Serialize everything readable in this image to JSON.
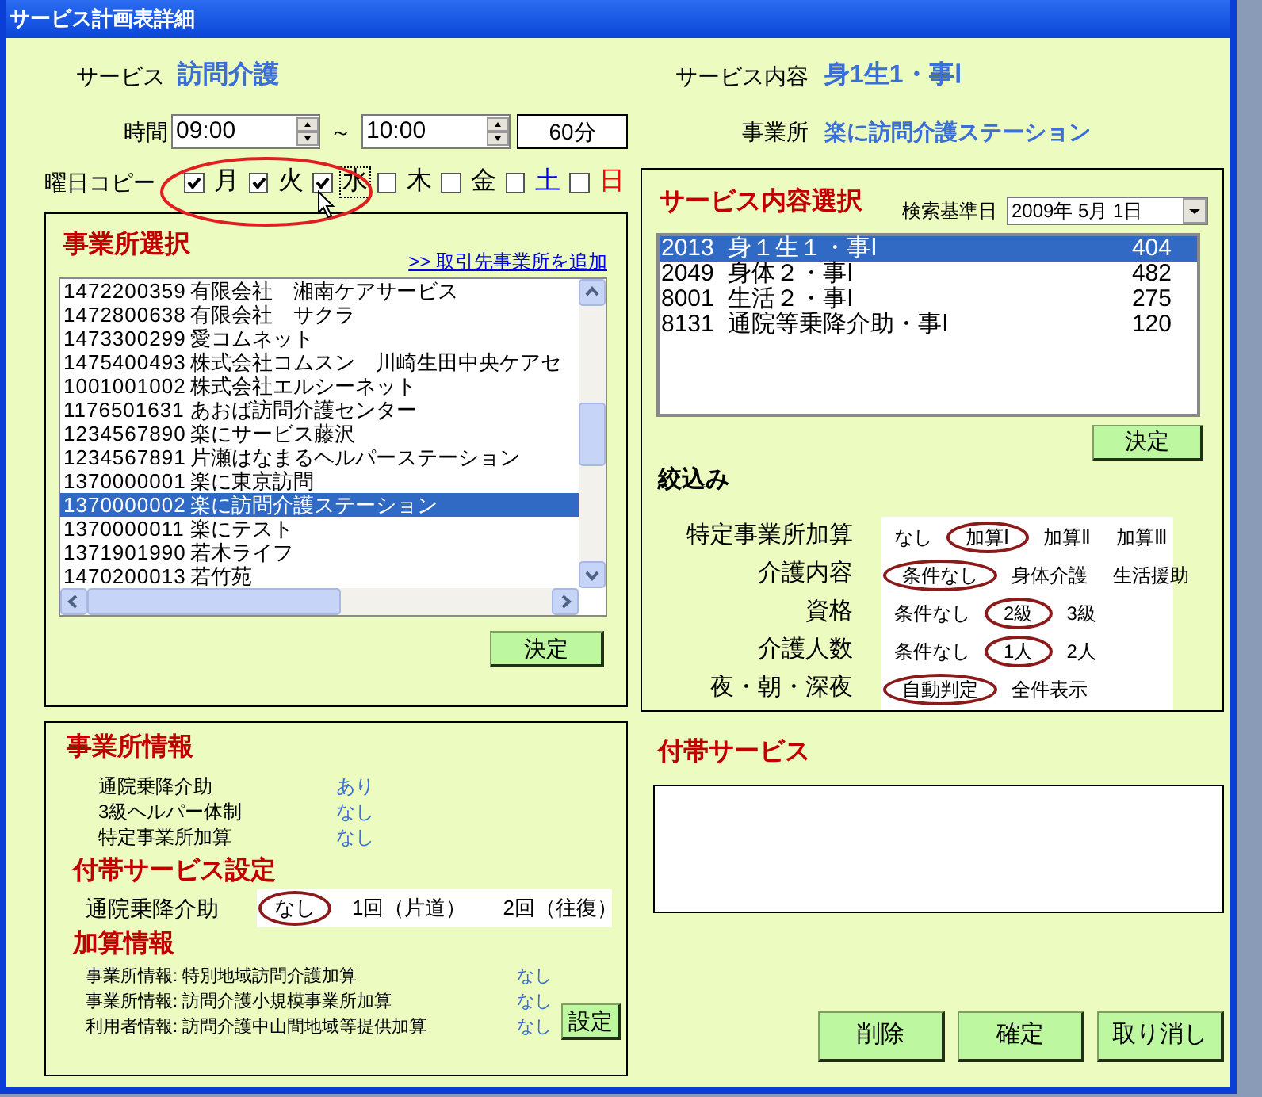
{
  "window": {
    "title": "サービス計画表詳細"
  },
  "service": {
    "label": "サービス",
    "value": "訪問介護"
  },
  "time": {
    "label": "時間",
    "start": "09:00",
    "separator": "～",
    "end": "10:00",
    "duration": "60分"
  },
  "day_copy": {
    "label": "曜日コピー",
    "days": [
      {
        "label": "月",
        "checked": true,
        "focused": false,
        "color": "#000000"
      },
      {
        "label": "火",
        "checked": true,
        "focused": false,
        "color": "#000000"
      },
      {
        "label": "水",
        "checked": true,
        "focused": true,
        "color": "#000000"
      },
      {
        "label": "木",
        "checked": false,
        "focused": false,
        "color": "#000000"
      },
      {
        "label": "金",
        "checked": false,
        "focused": false,
        "color": "#000000"
      },
      {
        "label": "土",
        "checked": false,
        "focused": false,
        "color": "#0000ff"
      },
      {
        "label": "日",
        "checked": false,
        "focused": false,
        "color": "#ff0000"
      }
    ]
  },
  "office_select": {
    "title": "事業所選択",
    "add_link": ">> 取引先事業所を追加",
    "rows": [
      {
        "code": "1472200359",
        "name": "有限会社　湘南ケアサービス",
        "selected": false
      },
      {
        "code": "1472800638",
        "name": "有限会社　サクラ",
        "selected": false
      },
      {
        "code": "1473300299",
        "name": "愛コムネット",
        "selected": false
      },
      {
        "code": "1475400493",
        "name": "株式会社コムスン　川崎生田中央ケアセ",
        "selected": false
      },
      {
        "code": "1001001002",
        "name": "株式会社エルシーネット",
        "selected": false
      },
      {
        "code": "1176501631",
        "name": "あおば訪問介護センター",
        "selected": false
      },
      {
        "code": "1234567890",
        "name": "楽にサービス藤沢",
        "selected": false
      },
      {
        "code": "1234567891",
        "name": "片瀬はなまるヘルパーステーション",
        "selected": false
      },
      {
        "code": "1370000001",
        "name": "楽に東京訪問",
        "selected": false
      },
      {
        "code": "1370000002",
        "name": "楽に訪問介護ステーション",
        "selected": true
      },
      {
        "code": "1370000011",
        "name": "楽にテスト",
        "selected": false
      },
      {
        "code": "1371901990",
        "name": "若木ライフ",
        "selected": false
      },
      {
        "code": "1470200013",
        "name": "若竹苑",
        "selected": false
      }
    ],
    "button": "決定"
  },
  "service_content": {
    "label": "サービス内容",
    "value": "身1生1・事Ⅰ"
  },
  "office": {
    "label": "事業所",
    "value": "楽に訪問介護ステーション"
  },
  "service_select": {
    "title": "サービス内容選択",
    "date_label": "検索基準日",
    "date": "2009年 5月 1日",
    "rows": [
      {
        "code": "2013",
        "name": "身１生１・事Ⅰ",
        "units": "404",
        "selected": true
      },
      {
        "code": "2049",
        "name": "身体２・事Ⅰ",
        "units": "482",
        "selected": false
      },
      {
        "code": "8001",
        "name": "生活２・事Ⅰ",
        "units": "275",
        "selected": false
      },
      {
        "code": "8131",
        "name": "通院等乗降介助・事Ⅰ",
        "units": "120",
        "selected": false
      }
    ],
    "button": "決定"
  },
  "filters": {
    "title": "絞込み",
    "rows": [
      {
        "label": "特定事業所加算",
        "options": [
          {
            "label": "なし",
            "selected": false
          },
          {
            "label": "加算Ⅰ",
            "selected": true
          },
          {
            "label": "加算Ⅱ",
            "selected": false
          },
          {
            "label": "加算Ⅲ",
            "selected": false
          }
        ]
      },
      {
        "label": "介護内容",
        "options": [
          {
            "label": "条件なし",
            "selected": true
          },
          {
            "label": "身体介護",
            "selected": false
          },
          {
            "label": "生活援助",
            "selected": false
          }
        ]
      },
      {
        "label": "資格",
        "options": [
          {
            "label": "条件なし",
            "selected": false
          },
          {
            "label": "2級",
            "selected": true
          },
          {
            "label": "3級",
            "selected": false
          }
        ]
      },
      {
        "label": "介護人数",
        "options": [
          {
            "label": "条件なし",
            "selected": false
          },
          {
            "label": "1人",
            "selected": true
          },
          {
            "label": "2人",
            "selected": false
          }
        ]
      },
      {
        "label": "夜・朝・深夜",
        "options": [
          {
            "label": "自動判定",
            "selected": true
          },
          {
            "label": "全件表示",
            "selected": false
          }
        ]
      }
    ]
  },
  "office_info": {
    "title": "事業所情報",
    "rows": [
      {
        "label": "通院乗降介助",
        "value": "あり"
      },
      {
        "label": "3級ヘルパー体制",
        "value": "なし"
      },
      {
        "label": "特定事業所加算",
        "value": "なし"
      }
    ]
  },
  "supplementary_setting": {
    "title": "付帯サービス設定",
    "label": "通院乗降介助",
    "options": [
      {
        "label": "なし",
        "selected": true
      },
      {
        "label": "1回（片道）",
        "selected": false
      },
      {
        "label": "2回（往復）",
        "selected": false
      }
    ]
  },
  "addition_info": {
    "title": "加算情報",
    "rows": [
      {
        "label": "事業所情報: 特別地域訪問介護加算",
        "value": "なし"
      },
      {
        "label": "事業所情報: 訪問介護小規模事業所加算",
        "value": "なし"
      },
      {
        "label": "利用者情報: 訪問介護中山間地域等提供加算",
        "value": "なし"
      }
    ],
    "button": "設定"
  },
  "supplementary_services": {
    "title": "付帯サービス"
  },
  "buttons": [
    "削除",
    "確定",
    "取り消し"
  ]
}
